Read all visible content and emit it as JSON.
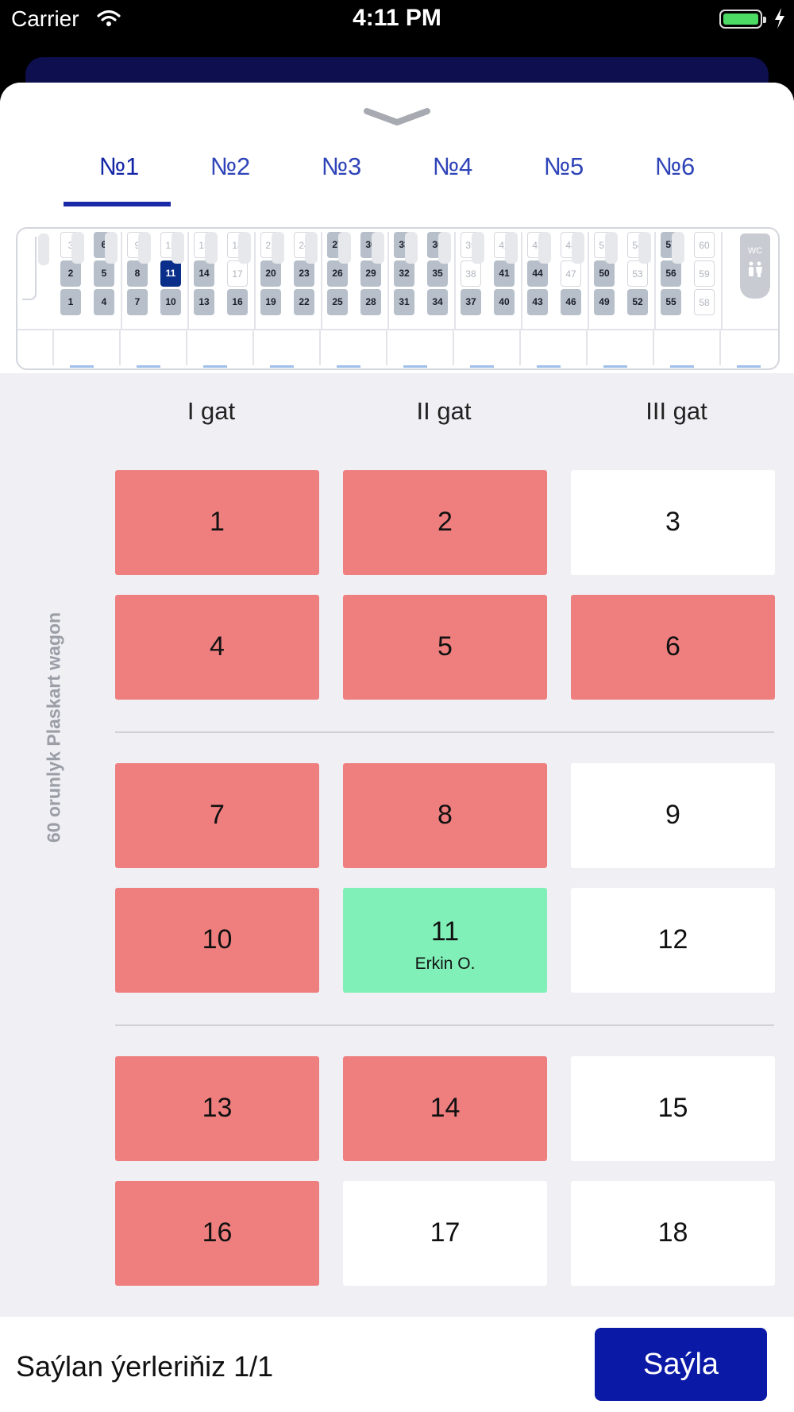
{
  "status_bar": {
    "carrier": "Carrier",
    "time": "4:11 PM",
    "battery_level": 1.0
  },
  "tabs": [
    {
      "label": "№1",
      "active": true
    },
    {
      "label": "№2",
      "active": false
    },
    {
      "label": "№3",
      "active": false
    },
    {
      "label": "№4",
      "active": false
    },
    {
      "label": "№5",
      "active": false
    },
    {
      "label": "№6",
      "active": false
    }
  ],
  "wagon_map": {
    "wc_label": "WC",
    "bays": [
      {
        "seats": [
          {
            "n": "3",
            "state": "free"
          },
          {
            "n": "2",
            "state": "taken"
          },
          {
            "n": "1",
            "state": "taken"
          }
        ]
      },
      {
        "seats": [
          {
            "n": "6",
            "state": "taken"
          },
          {
            "n": "5",
            "state": "taken"
          },
          {
            "n": "4",
            "state": "taken"
          }
        ]
      },
      {
        "seats": [
          {
            "n": "9",
            "state": "free"
          },
          {
            "n": "8",
            "state": "taken"
          },
          {
            "n": "7",
            "state": "taken"
          }
        ]
      },
      {
        "seats": [
          {
            "n": "12",
            "state": "free"
          },
          {
            "n": "11",
            "state": "selected"
          },
          {
            "n": "10",
            "state": "taken"
          }
        ]
      },
      {
        "seats": [
          {
            "n": "15",
            "state": "free"
          },
          {
            "n": "14",
            "state": "taken"
          },
          {
            "n": "13",
            "state": "taken"
          }
        ]
      },
      {
        "seats": [
          {
            "n": "18",
            "state": "free"
          },
          {
            "n": "17",
            "state": "free"
          },
          {
            "n": "16",
            "state": "taken"
          }
        ]
      },
      {
        "seats": [
          {
            "n": "21",
            "state": "free"
          },
          {
            "n": "20",
            "state": "taken"
          },
          {
            "n": "19",
            "state": "taken"
          }
        ]
      },
      {
        "seats": [
          {
            "n": "24",
            "state": "free"
          },
          {
            "n": "23",
            "state": "taken"
          },
          {
            "n": "22",
            "state": "taken"
          }
        ]
      },
      {
        "seats": [
          {
            "n": "27",
            "state": "taken"
          },
          {
            "n": "26",
            "state": "taken"
          },
          {
            "n": "25",
            "state": "taken"
          }
        ]
      },
      {
        "seats": [
          {
            "n": "30",
            "state": "taken"
          },
          {
            "n": "29",
            "state": "taken"
          },
          {
            "n": "28",
            "state": "taken"
          }
        ]
      },
      {
        "seats": [
          {
            "n": "33",
            "state": "taken"
          },
          {
            "n": "32",
            "state": "taken"
          },
          {
            "n": "31",
            "state": "taken"
          }
        ]
      },
      {
        "seats": [
          {
            "n": "36",
            "state": "taken"
          },
          {
            "n": "35",
            "state": "taken"
          },
          {
            "n": "34",
            "state": "taken"
          }
        ]
      },
      {
        "seats": [
          {
            "n": "39",
            "state": "free"
          },
          {
            "n": "38",
            "state": "free"
          },
          {
            "n": "37",
            "state": "taken"
          }
        ]
      },
      {
        "seats": [
          {
            "n": "42",
            "state": "free"
          },
          {
            "n": "41",
            "state": "taken"
          },
          {
            "n": "40",
            "state": "taken"
          }
        ]
      },
      {
        "seats": [
          {
            "n": "45",
            "state": "free"
          },
          {
            "n": "44",
            "state": "taken"
          },
          {
            "n": "43",
            "state": "taken"
          }
        ]
      },
      {
        "seats": [
          {
            "n": "48",
            "state": "free"
          },
          {
            "n": "47",
            "state": "free"
          },
          {
            "n": "46",
            "state": "taken"
          }
        ]
      },
      {
        "seats": [
          {
            "n": "51",
            "state": "free"
          },
          {
            "n": "50",
            "state": "taken"
          },
          {
            "n": "49",
            "state": "taken"
          }
        ]
      },
      {
        "seats": [
          {
            "n": "54",
            "state": "free"
          },
          {
            "n": "53",
            "state": "free"
          },
          {
            "n": "52",
            "state": "taken"
          }
        ]
      },
      {
        "seats": [
          {
            "n": "57",
            "state": "taken"
          },
          {
            "n": "56",
            "state": "taken"
          },
          {
            "n": "55",
            "state": "taken"
          }
        ]
      },
      {
        "seats": [
          {
            "n": "60",
            "state": "free"
          },
          {
            "n": "59",
            "state": "free"
          },
          {
            "n": "58",
            "state": "free"
          }
        ]
      }
    ]
  },
  "columns": [
    "I gat",
    "II gat",
    "III gat"
  ],
  "wagon_label": "60 orunlyk Plaskart wagon",
  "seat_rows": [
    [
      {
        "n": "1",
        "state": "taken"
      },
      {
        "n": "2",
        "state": "taken"
      },
      {
        "n": "3",
        "state": "free"
      }
    ],
    [
      {
        "n": "4",
        "state": "taken"
      },
      {
        "n": "5",
        "state": "taken"
      },
      {
        "n": "6",
        "state": "taken"
      }
    ],
    [
      {
        "n": "7",
        "state": "taken"
      },
      {
        "n": "8",
        "state": "taken"
      },
      {
        "n": "9",
        "state": "free"
      }
    ],
    [
      {
        "n": "10",
        "state": "taken"
      },
      {
        "n": "11",
        "state": "selected",
        "passenger": "Erkin O."
      },
      {
        "n": "12",
        "state": "free"
      }
    ],
    [
      {
        "n": "13",
        "state": "taken"
      },
      {
        "n": "14",
        "state": "taken"
      },
      {
        "n": "15",
        "state": "free"
      }
    ],
    [
      {
        "n": "16",
        "state": "taken"
      },
      {
        "n": "17",
        "state": "free"
      },
      {
        "n": "18",
        "state": "free"
      }
    ]
  ],
  "colors": {
    "taken": "#ef7f7f",
    "free": "#ffffff",
    "selected": "#80f0b8",
    "accent": "#0a19a6"
  },
  "bottom": {
    "label": "Saýlan ýerleriňiz 1/1",
    "button": "Saýla"
  }
}
